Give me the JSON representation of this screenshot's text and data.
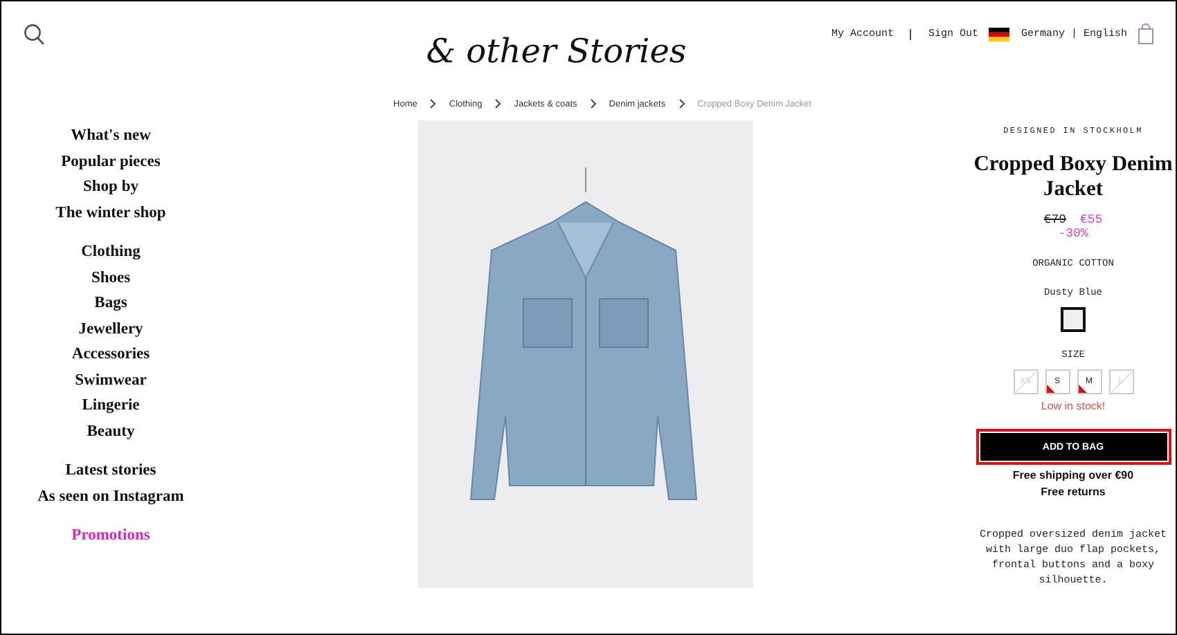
{
  "header": {
    "logo": "& other Stories",
    "links": [
      {
        "label": "My Account"
      },
      {
        "label": "Sign Out"
      }
    ],
    "locale": "Germany | English"
  },
  "breadcrumb": [
    {
      "label": "Home",
      "current": false
    },
    {
      "label": "Clothing",
      "current": false
    },
    {
      "label": "Jackets & coats",
      "current": false
    },
    {
      "label": "Denim jackets",
      "current": false
    },
    {
      "label": "Cropped Boxy Denim Jacket",
      "current": true
    }
  ],
  "nav_groups": [
    {
      "items": [
        {
          "label": "What's new",
          "highlight": false
        },
        {
          "label": "Popular pieces",
          "highlight": false
        },
        {
          "label": "Shop by",
          "highlight": false
        },
        {
          "label": "The winter shop",
          "highlight": false
        }
      ]
    },
    {
      "items": [
        {
          "label": "Clothing",
          "highlight": false
        },
        {
          "label": "Shoes",
          "highlight": false
        },
        {
          "label": "Bags",
          "highlight": false
        },
        {
          "label": "Jewellery",
          "highlight": false
        },
        {
          "label": "Accessories",
          "highlight": false
        },
        {
          "label": "Swimwear",
          "highlight": false
        },
        {
          "label": "Lingerie",
          "highlight": false
        },
        {
          "label": "Beauty",
          "highlight": false
        }
      ]
    },
    {
      "items": [
        {
          "label": "Latest stories",
          "highlight": false
        },
        {
          "label": "As seen on Instagram",
          "highlight": false
        }
      ]
    },
    {
      "items": [
        {
          "label": "Promotions",
          "highlight": true
        }
      ]
    }
  ],
  "product": {
    "tagline": "DESIGNED IN STOCKHOLM",
    "name": "Cropped Boxy Denim Jacket",
    "old_price": "€79",
    "price": "€55",
    "discount": "-30%",
    "material": "ORGANIC COTTON",
    "color_name": "Dusty Blue",
    "size_label": "SIZE",
    "sizes": [
      {
        "label": "XS",
        "available": false,
        "low_stock": false
      },
      {
        "label": "S",
        "available": true,
        "low_stock": true
      },
      {
        "label": "M",
        "available": true,
        "low_stock": true
      },
      {
        "label": "L",
        "available": false,
        "low_stock": false
      }
    ],
    "stock_note": "Low in stock!",
    "add_button": "ADD TO BAG",
    "shipping": "Free shipping over €90",
    "returns": "Free returns",
    "description": "Cropped oversized denim jacket with large duo flap pockets, frontal buttons and a boxy silhouette."
  }
}
